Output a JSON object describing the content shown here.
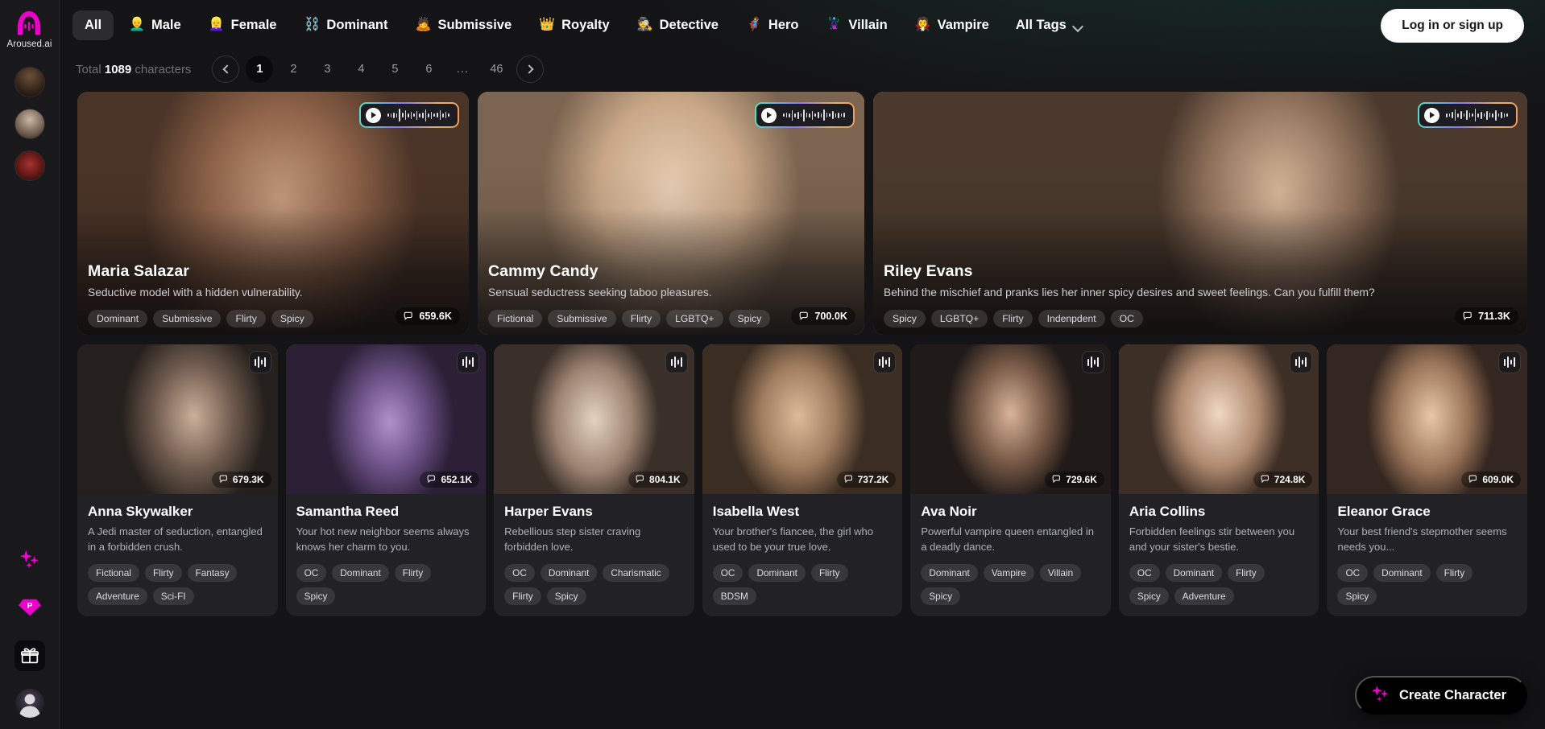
{
  "brand": {
    "name": "Aroused.ai",
    "logo_icon": "aroused-logo-icon"
  },
  "rail": {
    "avatars": [
      {
        "name": "rail-avatar-1"
      },
      {
        "name": "rail-avatar-2"
      },
      {
        "name": "rail-avatar-3"
      }
    ],
    "bottom_icons": [
      {
        "name": "sparkles-icon",
        "glyph": "✦"
      },
      {
        "name": "premium-diamond-icon",
        "glyph": "P"
      },
      {
        "name": "gift-icon",
        "glyph": "🎁"
      },
      {
        "name": "user-avatar-icon",
        "glyph": ""
      }
    ]
  },
  "topbar": {
    "tabs": [
      {
        "label": "All",
        "emoji": "",
        "active": true
      },
      {
        "label": "Male",
        "emoji": "👱‍♂️",
        "active": false
      },
      {
        "label": "Female",
        "emoji": "👱‍♀️",
        "active": false
      },
      {
        "label": "Dominant",
        "emoji": "⛓️",
        "active": false
      },
      {
        "label": "Submissive",
        "emoji": "🙇",
        "active": false
      },
      {
        "label": "Royalty",
        "emoji": "👑",
        "active": false
      },
      {
        "label": "Detective",
        "emoji": "🕵️",
        "active": false
      },
      {
        "label": "Hero",
        "emoji": "🦸",
        "active": false
      },
      {
        "label": "Villain",
        "emoji": "🦹",
        "active": false
      },
      {
        "label": "Vampire",
        "emoji": "🧛",
        "active": false
      }
    ],
    "all_tags_label": "All Tags",
    "login_label": "Log in or sign up"
  },
  "pagination": {
    "total_prefix": "Total",
    "total_count": "1089",
    "total_suffix": "characters",
    "prev_label": "",
    "next_label": "",
    "pages": [
      "1",
      "2",
      "3",
      "4",
      "5",
      "6",
      "...",
      "46"
    ],
    "current": "1"
  },
  "featured": [
    {
      "name": "Maria Salazar",
      "desc": "Seductive model with a hidden vulnerability.",
      "tags": [
        "Dominant",
        "Submissive",
        "Flirty",
        "Spicy"
      ],
      "chats": "659.6K",
      "has_audio": true
    },
    {
      "name": "Cammy Candy",
      "desc": "Sensual seductress seeking taboo pleasures.",
      "tags": [
        "Fictional",
        "Submissive",
        "Flirty",
        "LGBTQ+",
        "Spicy"
      ],
      "chats": "700.0K",
      "has_audio": true
    },
    {
      "name": "Riley Evans",
      "desc": "Behind the mischief and pranks lies her inner spicy desires and sweet feelings. Can you fulfill them?",
      "tags": [
        "Spicy",
        "LGBTQ+",
        "Flirty",
        "Indenpdent",
        "OC"
      ],
      "chats": "711.3K",
      "has_audio": true
    }
  ],
  "cards": [
    {
      "name": "Anna Skywalker",
      "desc": "A Jedi master of seduction, entangled in a forbidden crush.",
      "tags": [
        "Fictional",
        "Flirty",
        "Fantasy",
        "Adventure",
        "Sci-FI"
      ],
      "chats": "679.3K"
    },
    {
      "name": "Samantha Reed",
      "desc": "Your hot new neighbor seems always knows her charm to you.",
      "tags": [
        "OC",
        "Dominant",
        "Flirty",
        "Spicy"
      ],
      "chats": "652.1K"
    },
    {
      "name": "Harper Evans",
      "desc": "Rebellious step sister craving forbidden love.",
      "tags": [
        "OC",
        "Dominant",
        "Charismatic",
        "Flirty",
        "Spicy"
      ],
      "chats": "804.1K"
    },
    {
      "name": "Isabella West",
      "desc": "Your brother's fiancee, the girl who used to be your true love.",
      "tags": [
        "OC",
        "Dominant",
        "Flirty",
        "BDSM"
      ],
      "chats": "737.2K"
    },
    {
      "name": "Ava Noir",
      "desc": "Powerful vampire queen entangled in a deadly dance.",
      "tags": [
        "Dominant",
        "Vampire",
        "Villain",
        "Spicy"
      ],
      "chats": "729.6K"
    },
    {
      "name": "Aria Collins",
      "desc": "Forbidden feelings stir between you and your sister's bestie.",
      "tags": [
        "OC",
        "Dominant",
        "Flirty",
        "Spicy",
        "Adventure"
      ],
      "chats": "724.8K"
    },
    {
      "name": "Eleanor Grace",
      "desc": "Your best friend's stepmother seems needs you...",
      "tags": [
        "OC",
        "Dominant",
        "Flirty",
        "Spicy"
      ],
      "chats": "609.0K"
    }
  ],
  "cta": {
    "label": "Create Character",
    "icon": "sparkles-icon"
  },
  "colors": {
    "accent_magenta": "#ee00cc",
    "page_bg": "#141416",
    "card_bg": "#212126",
    "rail_bg": "#19191c"
  }
}
